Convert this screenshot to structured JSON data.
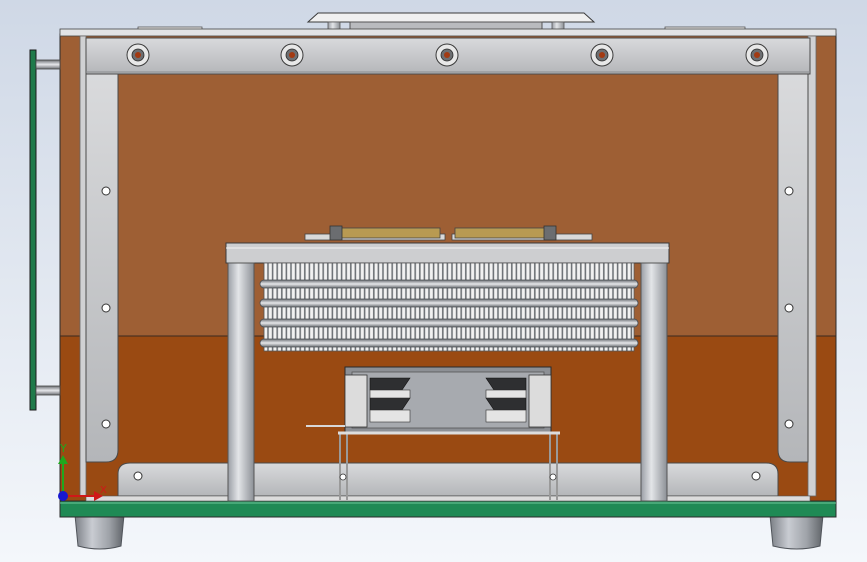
{
  "viewport": {
    "background_top": "#cfd8e6",
    "background_bottom": "#f4f7fb"
  },
  "model": {
    "enclosure_color": "#9e5f34",
    "enclosure_lower_color": "#9a4a12",
    "frame_color": "#c9cacc",
    "base_plate_color": "#1f8a55",
    "pcb_color": "#1f7a4a",
    "brass_color": "#b89a52",
    "hole_color": "#a33a12"
  },
  "triad": {
    "y_axis_label": "Y",
    "x_axis_label": "X",
    "y_axis_color": "#1ea81e",
    "x_axis_color": "#d01818",
    "z_axis_color": "#1818d0"
  }
}
